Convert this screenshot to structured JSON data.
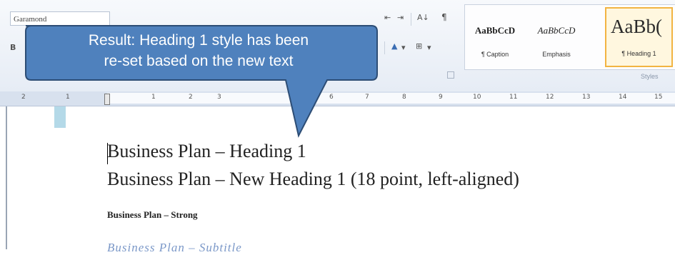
{
  "ribbon": {
    "font_name": "Garamond",
    "para_symbol": "¶",
    "sort_symbol": "A↓",
    "styles": [
      {
        "sample": "AaBbCcD",
        "name": "¶ Caption"
      },
      {
        "sample": "AaBbCcD",
        "name": "Emphasis"
      },
      {
        "sample": "AaBb(",
        "name": "¶ Heading 1"
      }
    ],
    "group_label": "Styles"
  },
  "ruler": {
    "numbers": [
      "2",
      "1",
      "1",
      "2",
      "3",
      "6",
      "7",
      "8",
      "9",
      "10",
      "11",
      "12",
      "13",
      "14",
      "15"
    ]
  },
  "callout": {
    "line1": "Result: Heading 1 style has been",
    "line2": "re-set based on the new text",
    "fill_color": "#4f81bd",
    "border_color": "#2d4d75"
  },
  "document": {
    "heading1": "Business Plan – Heading 1",
    "heading1_new": "Business Plan – New Heading 1 (18 point, left-aligned)",
    "strong": "Business Plan – Strong",
    "subtitle": "Business Plan – Subtitle"
  }
}
